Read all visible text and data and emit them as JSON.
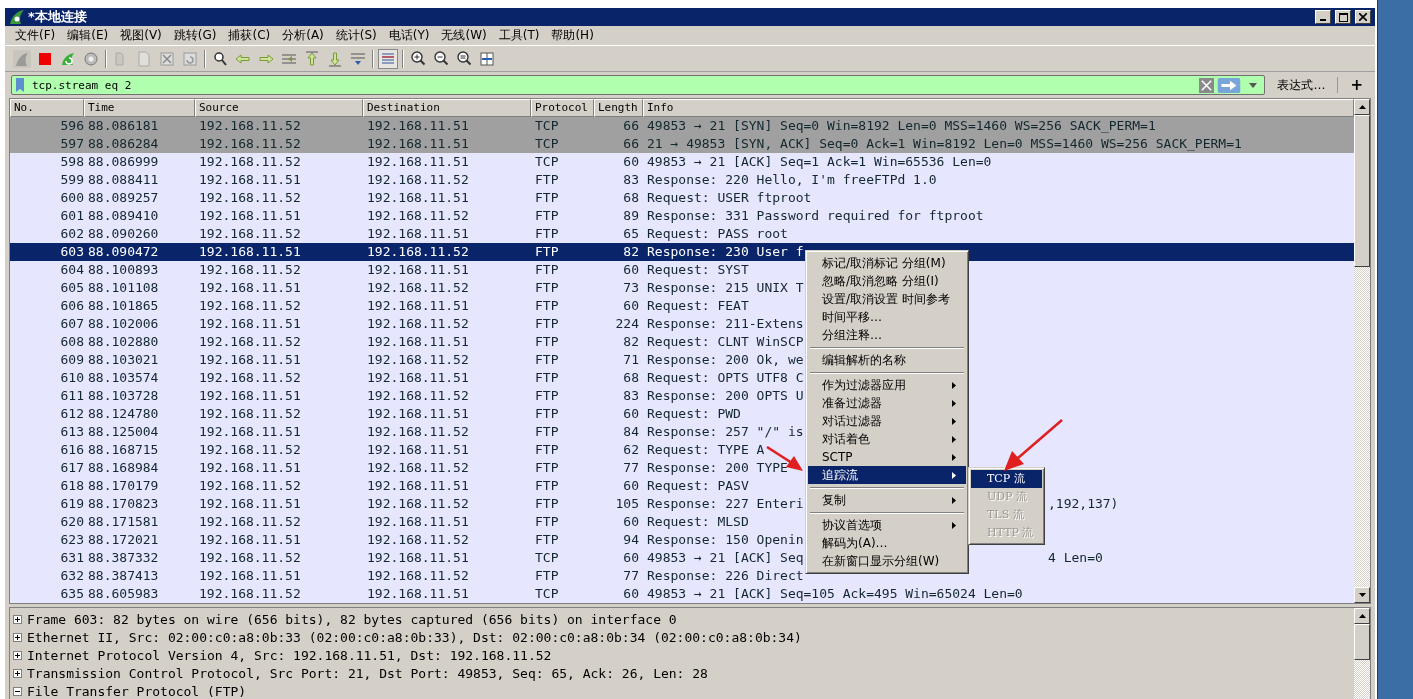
{
  "window": {
    "title": "*本地连接"
  },
  "menu_bar": [
    "文件(F)",
    "编辑(E)",
    "视图(V)",
    "跳转(G)",
    "捕获(C)",
    "分析(A)",
    "统计(S)",
    "电话(Y)",
    "无线(W)",
    "工具(T)",
    "帮助(H)"
  ],
  "filter": {
    "value": "tcp.stream eq 2",
    "expression_button": "表达式…",
    "add_button": "+"
  },
  "packet_list": {
    "columns": [
      "No.",
      "Time",
      "Source",
      "Destination",
      "Protocol",
      "Length",
      "Info"
    ],
    "rows": [
      {
        "no": "596",
        "time": "88.086181",
        "source": "192.168.11.52",
        "destination": "192.168.11.51",
        "protocol": "TCP",
        "length": "66",
        "info": "49853 → 21 [SYN] Seq=0 Win=8192 Len=0 MSS=1460 WS=256 SACK_PERM=1",
        "color": "#a0a0a0",
        "selected": false
      },
      {
        "no": "597",
        "time": "88.086284",
        "source": "192.168.11.52",
        "destination": "192.168.11.51",
        "protocol": "TCP",
        "length": "66",
        "info": "21 → 49853 [SYN, ACK] Seq=0 Ack=1 Win=8192 Len=0 MSS=1460 WS=256 SACK_PERM=1",
        "color": "#a0a0a0",
        "selected": false
      },
      {
        "no": "598",
        "time": "88.086999",
        "source": "192.168.11.52",
        "destination": "192.168.11.51",
        "protocol": "TCP",
        "length": "60",
        "info": "49853 → 21 [ACK] Seq=1 Ack=1 Win=65536 Len=0",
        "color": "#e7e6ff",
        "selected": false
      },
      {
        "no": "599",
        "time": "88.088411",
        "source": "192.168.11.51",
        "destination": "192.168.11.52",
        "protocol": "FTP",
        "length": "83",
        "info": "Response: 220 Hello, I'm freeFTPd 1.0",
        "color": "#e7e6ff",
        "selected": false
      },
      {
        "no": "600",
        "time": "88.089257",
        "source": "192.168.11.52",
        "destination": "192.168.11.51",
        "protocol": "FTP",
        "length": "68",
        "info": "Request: USER ftproot",
        "color": "#e7e6ff",
        "selected": false
      },
      {
        "no": "601",
        "time": "88.089410",
        "source": "192.168.11.51",
        "destination": "192.168.11.52",
        "protocol": "FTP",
        "length": "89",
        "info": "Response: 331 Password required for ftproot",
        "color": "#e7e6ff",
        "selected": false
      },
      {
        "no": "602",
        "time": "88.090260",
        "source": "192.168.11.52",
        "destination": "192.168.11.51",
        "protocol": "FTP",
        "length": "65",
        "info": "Request: PASS root",
        "color": "#e7e6ff",
        "selected": false
      },
      {
        "no": "603",
        "time": "88.090472",
        "source": "192.168.11.51",
        "destination": "192.168.11.52",
        "protocol": "FTP",
        "length": "82",
        "info": "Response: 230 User f",
        "selected": true
      },
      {
        "no": "604",
        "time": "88.100893",
        "source": "192.168.11.52",
        "destination": "192.168.11.51",
        "protocol": "FTP",
        "length": "60",
        "info": "Request: SYST",
        "color": "#e7e6ff",
        "selected": false
      },
      {
        "no": "605",
        "time": "88.101108",
        "source": "192.168.11.51",
        "destination": "192.168.11.52",
        "protocol": "FTP",
        "length": "73",
        "info": "Response: 215 UNIX T",
        "color": "#e7e6ff",
        "selected": false
      },
      {
        "no": "606",
        "time": "88.101865",
        "source": "192.168.11.52",
        "destination": "192.168.11.51",
        "protocol": "FTP",
        "length": "60",
        "info": "Request: FEAT",
        "color": "#e7e6ff",
        "selected": false
      },
      {
        "no": "607",
        "time": "88.102006",
        "source": "192.168.11.51",
        "destination": "192.168.11.52",
        "protocol": "FTP",
        "length": "224",
        "info": "Response: 211-Extens",
        "color": "#e7e6ff",
        "selected": false
      },
      {
        "no": "608",
        "time": "88.102880",
        "source": "192.168.11.52",
        "destination": "192.168.11.51",
        "protocol": "FTP",
        "length": "82",
        "info": "Request: CLNT WinSCP",
        "color": "#e7e6ff",
        "selected": false
      },
      {
        "no": "609",
        "time": "88.103021",
        "source": "192.168.11.51",
        "destination": "192.168.11.52",
        "protocol": "FTP",
        "length": "71",
        "info": "Response: 200 Ok, we",
        "color": "#e7e6ff",
        "selected": false
      },
      {
        "no": "610",
        "time": "88.103574",
        "source": "192.168.11.52",
        "destination": "192.168.11.51",
        "protocol": "FTP",
        "length": "68",
        "info": "Request: OPTS UTF8 C",
        "color": "#e7e6ff",
        "selected": false
      },
      {
        "no": "611",
        "time": "88.103728",
        "source": "192.168.11.51",
        "destination": "192.168.11.52",
        "protocol": "FTP",
        "length": "83",
        "info": "Response: 200 OPTS U",
        "color": "#e7e6ff",
        "selected": false
      },
      {
        "no": "612",
        "time": "88.124780",
        "source": "192.168.11.52",
        "destination": "192.168.11.51",
        "protocol": "FTP",
        "length": "60",
        "info": "Request: PWD",
        "color": "#e7e6ff",
        "selected": false
      },
      {
        "no": "613",
        "time": "88.125004",
        "source": "192.168.11.51",
        "destination": "192.168.11.52",
        "protocol": "FTP",
        "length": "84",
        "info": "Response: 257 \"/\" is",
        "color": "#e7e6ff",
        "selected": false
      },
      {
        "no": "616",
        "time": "88.168715",
        "source": "192.168.11.52",
        "destination": "192.168.11.51",
        "protocol": "FTP",
        "length": "62",
        "info": "Request: TYPE A",
        "color": "#e7e6ff",
        "selected": false
      },
      {
        "no": "617",
        "time": "88.168984",
        "source": "192.168.11.51",
        "destination": "192.168.11.52",
        "protocol": "FTP",
        "length": "77",
        "info": "Response: 200 TYPE",
        "color": "#e7e6ff",
        "selected": false
      },
      {
        "no": "618",
        "time": "88.170179",
        "source": "192.168.11.52",
        "destination": "192.168.11.51",
        "protocol": "FTP",
        "length": "60",
        "info": "Request: PASV",
        "color": "#e7e6ff",
        "selected": false
      },
      {
        "no": "619",
        "time": "88.170823",
        "source": "192.168.11.51",
        "destination": "192.168.11.52",
        "protocol": "FTP",
        "length": "105",
        "info": "Response: 227 Enteri",
        "info_tail": ",192,137)",
        "color": "#e7e6ff",
        "selected": false
      },
      {
        "no": "620",
        "time": "88.171581",
        "source": "192.168.11.52",
        "destination": "192.168.11.51",
        "protocol": "FTP",
        "length": "60",
        "info": "Request: MLSD",
        "color": "#e7e6ff",
        "selected": false
      },
      {
        "no": "623",
        "time": "88.172021",
        "source": "192.168.11.51",
        "destination": "192.168.11.52",
        "protocol": "FTP",
        "length": "94",
        "info": "Response: 150 Openin",
        "color": "#e7e6ff",
        "selected": false
      },
      {
        "no": "631",
        "time": "88.387332",
        "source": "192.168.11.52",
        "destination": "192.168.11.51",
        "protocol": "TCP",
        "length": "60",
        "info": "49853 → 21 [ACK] Seq",
        "info_tail": "4 Len=0",
        "color": "#e7e6ff",
        "selected": false
      },
      {
        "no": "632",
        "time": "88.387413",
        "source": "192.168.11.51",
        "destination": "192.168.11.52",
        "protocol": "FTP",
        "length": "77",
        "info": "Response: 226 Direct",
        "color": "#e7e6ff",
        "selected": false
      },
      {
        "no": "635",
        "time": "88.605983",
        "source": "192.168.11.52",
        "destination": "192.168.11.51",
        "protocol": "TCP",
        "length": "60",
        "info": "49853 → 21 [ACK] Seq=105 Ack=495 Win=65024 Len=0",
        "color": "#e7e6ff",
        "selected": false
      }
    ]
  },
  "details": [
    {
      "text": "Frame 603: 82 bytes on wire (656 bits), 82 bytes captured (656 bits) on interface 0",
      "expanded": false
    },
    {
      "text": "Ethernet II, Src: 02:00:c0:a8:0b:33 (02:00:c0:a8:0b:33), Dst: 02:00:c0:a8:0b:34 (02:00:c0:a8:0b:34)",
      "expanded": false
    },
    {
      "text": "Internet Protocol Version 4, Src: 192.168.11.51, Dst: 192.168.11.52",
      "expanded": false
    },
    {
      "text": "Transmission Control Protocol, Src Port: 21, Dst Port: 49853, Seq: 65, Ack: 26, Len: 28",
      "expanded": false
    },
    {
      "text": "File Transfer Protocol (FTP)",
      "expanded": true
    }
  ],
  "context_menu": [
    {
      "kind": "item",
      "label": "标记/取消标记 分组(M)",
      "submenu": false,
      "selected": false
    },
    {
      "kind": "item",
      "label": "忽略/取消忽略 分组(I)",
      "submenu": false,
      "selected": false
    },
    {
      "kind": "item",
      "label": "设置/取消设置 时间参考",
      "submenu": false,
      "selected": false
    },
    {
      "kind": "item",
      "label": "时间平移…",
      "submenu": false,
      "selected": false
    },
    {
      "kind": "item",
      "label": "分组注释…",
      "submenu": false,
      "selected": false
    },
    {
      "kind": "separator"
    },
    {
      "kind": "item",
      "label": "编辑解析的名称",
      "submenu": false,
      "selected": false
    },
    {
      "kind": "separator"
    },
    {
      "kind": "item",
      "label": "作为过滤器应用",
      "submenu": true,
      "selected": false
    },
    {
      "kind": "item",
      "label": "准备过滤器",
      "submenu": true,
      "selected": false
    },
    {
      "kind": "item",
      "label": "对话过滤器",
      "submenu": true,
      "selected": false
    },
    {
      "kind": "item",
      "label": "对话着色",
      "submenu": true,
      "selected": false
    },
    {
      "kind": "item",
      "label": "SCTP",
      "submenu": true,
      "selected": false
    },
    {
      "kind": "item",
      "label": "追踪流",
      "submenu": true,
      "selected": true
    },
    {
      "kind": "separator"
    },
    {
      "kind": "item",
      "label": "复制",
      "submenu": true,
      "selected": false
    },
    {
      "kind": "separator"
    },
    {
      "kind": "item",
      "label": "协议首选项",
      "submenu": true,
      "selected": false
    },
    {
      "kind": "item",
      "label": "解码为(A)…",
      "submenu": false,
      "selected": false
    },
    {
      "kind": "item",
      "label": "在新窗口显示分组(W)",
      "submenu": false,
      "selected": false
    }
  ],
  "submenu": [
    {
      "label": "TCP 流",
      "selected": true,
      "disabled": false
    },
    {
      "label": "UDP 流",
      "selected": false,
      "disabled": true
    },
    {
      "label": "TLS 流",
      "selected": false,
      "disabled": true
    },
    {
      "label": "HTTP 流",
      "selected": false,
      "disabled": true
    }
  ]
}
